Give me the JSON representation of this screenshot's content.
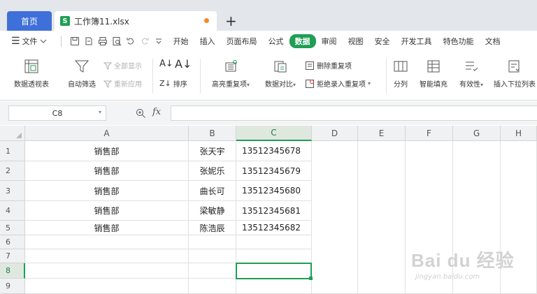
{
  "tabs": {
    "home_label": "首页",
    "file_icon": "S",
    "file_title": "工作簿11.xlsx",
    "new_tab": "+"
  },
  "menubar": {
    "file_label": "文件",
    "items": [
      "开始",
      "插入",
      "页面布局",
      "公式",
      "数据",
      "审阅",
      "视图",
      "安全",
      "开发工具",
      "特色功能",
      "文档"
    ],
    "active": "数据"
  },
  "ribbon": {
    "pivot_table": "数据透视表",
    "auto_filter": "自动筛选",
    "show_all": "全部显示",
    "reapply": "重新应用",
    "sort": "排序",
    "highlight_dup": "高亮重复项",
    "data_compare": "数据对比",
    "remove_dup": "删除重复项",
    "reject_dup": "拒绝录入重复项",
    "split_col": "分列",
    "smart_fill": "智能填充",
    "validity": "有效性",
    "insert_dropdown": "插入下拉列表"
  },
  "formula_bar": {
    "cell_ref": "C8",
    "fx": "fx",
    "value": ""
  },
  "grid": {
    "columns": [
      "A",
      "B",
      "C",
      "D",
      "E",
      "F",
      "G",
      "H"
    ],
    "rows": [
      {
        "num": "1",
        "a": "销售部",
        "b": "张天宇",
        "c": "13512345678"
      },
      {
        "num": "2",
        "a": "销售部",
        "b": "张妮乐",
        "c": "13512345679"
      },
      {
        "num": "3",
        "a": "销售部",
        "b": "曲长可",
        "c": "13512345680"
      },
      {
        "num": "4",
        "a": "销售部",
        "b": "梁敏静",
        "c": "13512345681"
      },
      {
        "num": "5",
        "a": "销售部",
        "b": "陈浩辰",
        "c": "13512345682"
      },
      {
        "num": "6",
        "a": "",
        "b": "",
        "c": ""
      },
      {
        "num": "7",
        "a": "",
        "b": "",
        "c": ""
      },
      {
        "num": "8",
        "a": "",
        "b": "",
        "c": ""
      },
      {
        "num": "9",
        "a": "",
        "b": "",
        "c": ""
      }
    ],
    "selected_col": "C",
    "selected_row": "8"
  },
  "watermark": {
    "main": "Bai du 经验",
    "sub": "jingyan.baidu.com"
  },
  "colors": {
    "accent_green": "#1f9e55",
    "home_blue": "#3f6fd8"
  }
}
